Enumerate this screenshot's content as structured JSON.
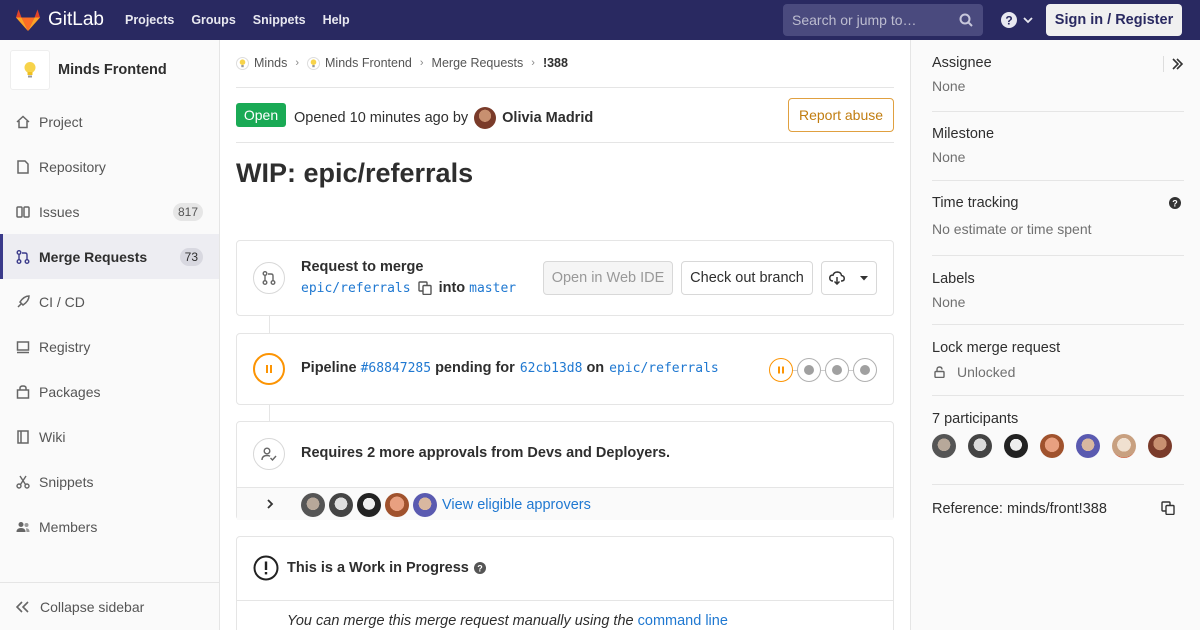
{
  "topbar": {
    "brand": "GitLab",
    "nav": [
      "Projects",
      "Groups",
      "Snippets",
      "Help"
    ],
    "search_placeholder": "Search or jump to…",
    "signin": "Sign in / Register"
  },
  "sidebar": {
    "project_name": "Minds Frontend",
    "items": [
      {
        "label": "Project",
        "icon": "home-icon"
      },
      {
        "label": "Repository",
        "icon": "doc-icon"
      },
      {
        "label": "Issues",
        "icon": "issues-icon",
        "count": "817"
      },
      {
        "label": "Merge Requests",
        "icon": "merge-icon",
        "count": "73",
        "active": true
      },
      {
        "label": "CI / CD",
        "icon": "rocket-icon"
      },
      {
        "label": "Registry",
        "icon": "container-icon"
      },
      {
        "label": "Packages",
        "icon": "package-icon"
      },
      {
        "label": "Wiki",
        "icon": "book-icon"
      },
      {
        "label": "Snippets",
        "icon": "scissors-icon"
      },
      {
        "label": "Members",
        "icon": "users-icon"
      }
    ],
    "collapse": "Collapse sidebar"
  },
  "breadcrumb": [
    "Minds",
    "Minds Frontend",
    "Merge Requests",
    "!388"
  ],
  "mr": {
    "status": "Open",
    "opened_prefix": "Opened",
    "opened_time": "10 minutes ago",
    "opened_by": "by",
    "author": "Olivia Madrid",
    "report": "Report abuse",
    "title": "WIP: epic/referrals"
  },
  "merge_widget": {
    "heading": "Request to merge",
    "source_branch": "epic/referrals",
    "into": "into",
    "target_branch": "master",
    "open_ide": "Open in Web IDE",
    "checkout": "Check out branch"
  },
  "pipeline": {
    "prefix": "Pipeline",
    "id": "#68847285",
    "status_text": "pending for",
    "commit": "62cb13d8",
    "on": "on",
    "branch": "epic/referrals"
  },
  "approvals": {
    "text": "Requires 2 more approvals from Devs and Deployers.",
    "link": "View eligible approvers"
  },
  "wip": {
    "title": "This is a Work in Progress",
    "text": "You can merge this merge request manually using the",
    "link": "command line"
  },
  "right_sidebar": {
    "assignee_label": "Assignee",
    "assignee_value": "None",
    "milestone_label": "Milestone",
    "milestone_value": "None",
    "time_label": "Time tracking",
    "time_value": "No estimate or time spent",
    "labels_label": "Labels",
    "labels_value": "None",
    "lock_label": "Lock merge request",
    "lock_value": "Unlocked",
    "participants_label": "7 participants",
    "reference": "Reference: minds/front!388"
  },
  "colors": {
    "nav": "#292961",
    "open": "#1aaa55",
    "link": "#1f78d1",
    "pending": "#fc9403",
    "report": "#e0a040"
  }
}
